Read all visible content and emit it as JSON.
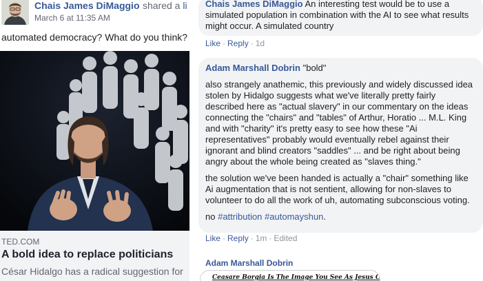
{
  "post": {
    "author": "Chais James DiMaggio",
    "action": "shared a",
    "action_link": "li",
    "time": "March 6 at 11:35 AM",
    "text": "automated democracy? What do you think?",
    "link": {
      "domain": "TED.COM",
      "title": "A bold idea to replace politicians",
      "description": "César Hidalgo has a radical suggestion for"
    }
  },
  "comments": [
    {
      "author": "Chais James DiMaggio",
      "text_first": "An interesting test would be to use a",
      "text_rest": "simulated population in combination with the AI to see what results might occur. A simulated country",
      "actions": {
        "like": "Like",
        "reply": "Reply",
        "time": "1d"
      }
    },
    {
      "author": "Adam Marshall Dobrin",
      "text_first": "\"bold\"",
      "paragraph_1": "also strangely anathemic, this previously and widely discussed idea stolen by Hidalgo suggests what we've literally pretty fairly described here as \"actual slavery\" in our commentary on the ideas connecting the \"chairs\" and \"tables\" of Arthur, Horatio ... M.L. King and with \"charity\" it's pretty easy to see how these \"Ai representatives\" probably would eventually rebel against their ignorant and blind creators \"saddles\" ... and be right about being angry about the whole being created as \"slaves thing.\"",
      "paragraph_2": "the solution we've been handed is actually a \"chair\" something like Ai augmentation that is not sentient, allowing for non-slaves to volunteer to do all the work of uh, automating subconscious voting.",
      "paragraph_3_prefix": "no",
      "hashtag_1": "#attribution",
      "hashtag_2": "#automayshun",
      "paragraph_3_suffix": ".",
      "actions": {
        "like": "Like",
        "reply": "Reply",
        "time": "1m",
        "edited": "Edited"
      }
    },
    {
      "author": "Adam Marshall Dobrin",
      "image_caption": "Ceasare Borgia Is The Image You See As Jesus Christ"
    }
  ],
  "separator": "·"
}
